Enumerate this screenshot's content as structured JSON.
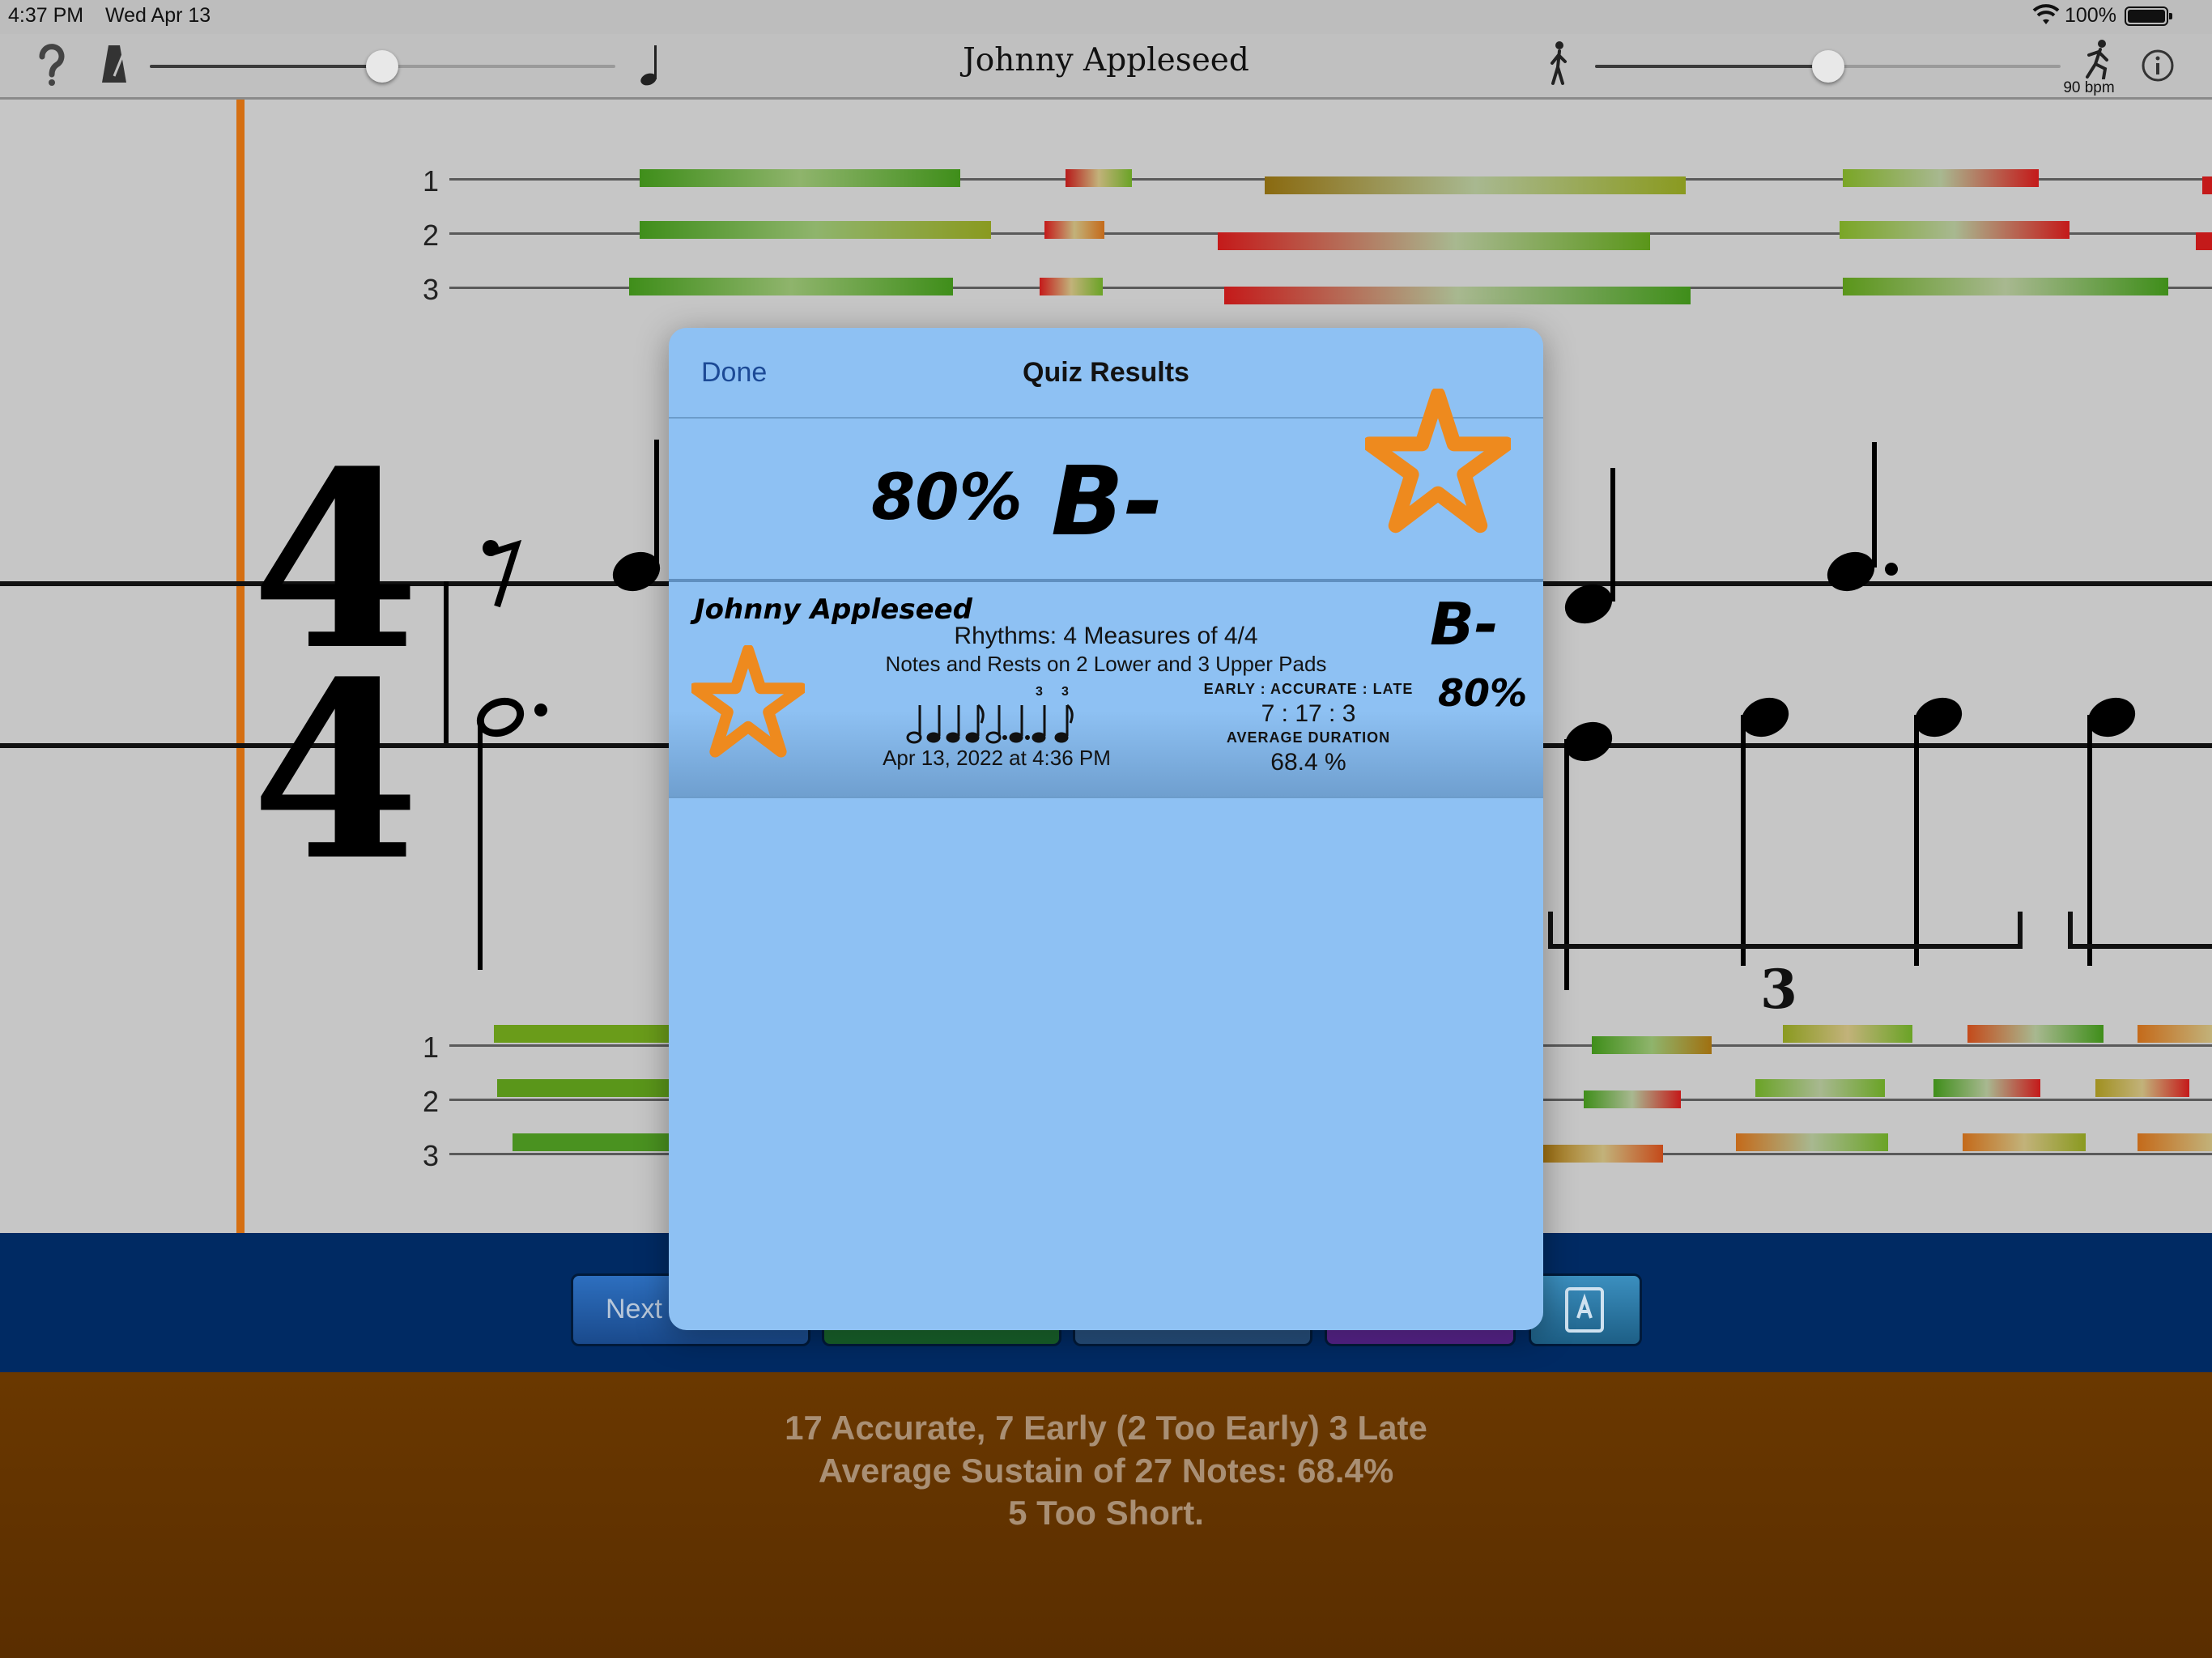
{
  "status_bar": {
    "time": "4:37 PM",
    "date": "Wed Apr 13",
    "battery_percent": "100%"
  },
  "toolbar": {
    "title": "Johnny Appleseed",
    "bpm_label": "90 bpm",
    "metronome_volume": 0.5,
    "tempo": 0.5,
    "icons": [
      "help-icon",
      "metronome-icon",
      "quarter-note-icon",
      "walking-icon",
      "running-icon",
      "info-icon"
    ]
  },
  "score": {
    "track_numbers": [
      "1",
      "2",
      "3"
    ],
    "time_signature": {
      "top": "4",
      "bottom": "4"
    },
    "tuplet_number": "3"
  },
  "bottom_bar": {
    "next_label": "Next"
  },
  "summary": {
    "line1": "17 Accurate, 7 Early (2 Too Early) 3 Late",
    "line2": "Average Sustain of 27 Notes: 68.4%",
    "line3": "5 Too Short."
  },
  "modal": {
    "done_label": "Done",
    "title": "Quiz Results",
    "score_percent": "80%",
    "grade": "B-",
    "result": {
      "song": "Johnny Appleseed",
      "description1": "Rhythms: 4 Measures of 4/4",
      "description2": "Notes and Rests on 2 Lower and 3 Upper Pads",
      "date": "Apr 13, 2022 at 4:36 PM",
      "timing_label": "EARLY : ACCURATE : LATE",
      "timing_value": "7 : 17 : 3",
      "avg_label": "AVERAGE DURATION",
      "avg_value": "68.4 %",
      "grade": "B-",
      "percent": "80%",
      "tuplet_marks": [
        "3",
        "3"
      ]
    }
  },
  "colors": {
    "accent": "#d56f12",
    "modal_bg": "#8ec1f3",
    "done_blue": "#1c4a96",
    "star_orange": "#ee8a1e"
  }
}
